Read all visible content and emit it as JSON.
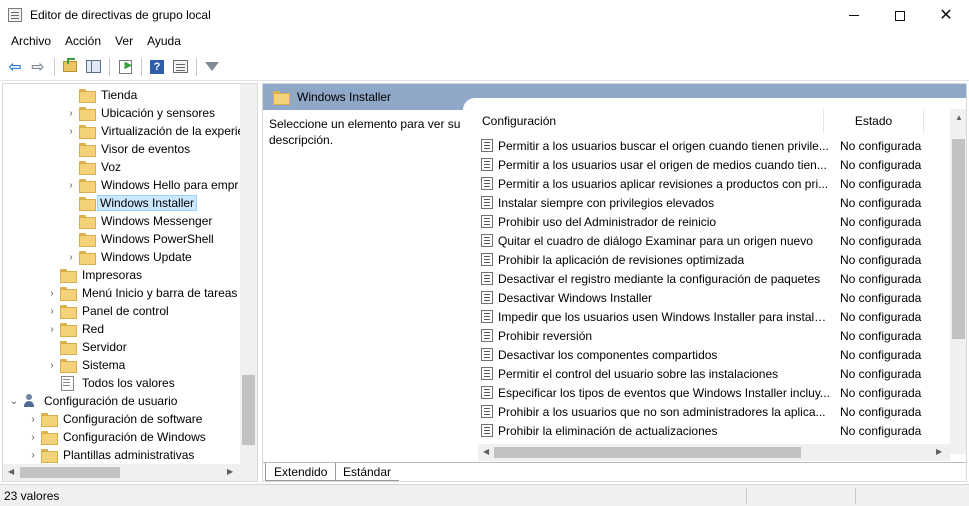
{
  "window": {
    "title": "Editor de directivas de grupo local",
    "minimize_glyph": "—",
    "maximize_glyph": "☐",
    "close_glyph": "✕"
  },
  "menu": {
    "archivo": "Archivo",
    "accion": "Acción",
    "ver": "Ver",
    "ayuda": "Ayuda"
  },
  "toolbar": {
    "back_icon": "arrow-left-icon",
    "forward_icon": "arrow-right-icon",
    "help_glyph": "?"
  },
  "tree": {
    "items": [
      {
        "label": "Tienda",
        "expander": ""
      },
      {
        "label": "Ubicación y sensores",
        "expander": "›"
      },
      {
        "label": "Virtualización de la experie",
        "expander": "›"
      },
      {
        "label": "Visor de eventos",
        "expander": ""
      },
      {
        "label": "Voz",
        "expander": ""
      },
      {
        "label": "Windows Hello para empr",
        "expander": "›"
      },
      {
        "label": "Windows Installer",
        "expander": ""
      },
      {
        "label": "Windows Messenger",
        "expander": ""
      },
      {
        "label": "Windows PowerShell",
        "expander": ""
      },
      {
        "label": "Windows Update",
        "expander": "›"
      },
      {
        "label": "Impresoras",
        "expander": ""
      },
      {
        "label": "Menú Inicio y barra de tareas",
        "expander": "›"
      },
      {
        "label": "Panel de control",
        "expander": "›"
      },
      {
        "label": "Red",
        "expander": "›"
      },
      {
        "label": "Servidor",
        "expander": ""
      },
      {
        "label": "Sistema",
        "expander": "›"
      },
      {
        "label": "Todos los valores",
        "expander": ""
      },
      {
        "label": "Configuración de usuario",
        "expander": "⌄"
      },
      {
        "label": "Configuración de software",
        "expander": "›"
      },
      {
        "label": "Configuración de Windows",
        "expander": "›"
      },
      {
        "label": "Plantillas administrativas",
        "expander": "›"
      }
    ],
    "selected": "Windows Installer"
  },
  "right": {
    "header_title": "Windows Installer",
    "description": "Seleccione un elemento para ver su descripción.",
    "col_config": "Configuración",
    "col_state": "Estado",
    "rows": [
      {
        "config": "Permitir a los usuarios buscar el origen cuando tienen privile...",
        "state": "No configurada"
      },
      {
        "config": "Permitir a los usuarios usar el origen de medios cuando tien...",
        "state": "No configurada"
      },
      {
        "config": "Permitir a los usuarios aplicar revisiones a productos con pri...",
        "state": "No configurada"
      },
      {
        "config": "Instalar siempre con privilegios elevados",
        "state": "No configurada"
      },
      {
        "config": "Prohibir uso del Administrador de reinicio",
        "state": "No configurada"
      },
      {
        "config": "Quitar el cuadro de diálogo Examinar para un origen nuevo",
        "state": "No configurada"
      },
      {
        "config": "Prohibir la aplicación de revisiones optimizada",
        "state": "No configurada"
      },
      {
        "config": "Desactivar el registro mediante la configuración de paquetes",
        "state": "No configurada"
      },
      {
        "config": "Desactivar Windows Installer",
        "state": "No configurada"
      },
      {
        "config": "Impedir que los usuarios usen Windows Installer para instala...",
        "state": "No configurada"
      },
      {
        "config": "Prohibir reversión",
        "state": "No configurada"
      },
      {
        "config": "Desactivar los componentes compartidos",
        "state": "No configurada"
      },
      {
        "config": "Permitir el control del usuario sobre las instalaciones",
        "state": "No configurada"
      },
      {
        "config": "Especificar los tipos de eventos que Windows Installer incluy...",
        "state": "No configurada"
      },
      {
        "config": "Prohibir a los usuarios que no son administradores la aplica...",
        "state": "No configurada"
      },
      {
        "config": "Prohibir la eliminación de actualizaciones",
        "state": "No configurada"
      }
    ],
    "tab_extended": "Extendido",
    "tab_standard": "Estándar"
  },
  "status": {
    "text": "23 valores"
  },
  "colors": {
    "header_bar": "#8fa8c7",
    "selection": "#cce8ff",
    "folder": "#f3d27a"
  }
}
